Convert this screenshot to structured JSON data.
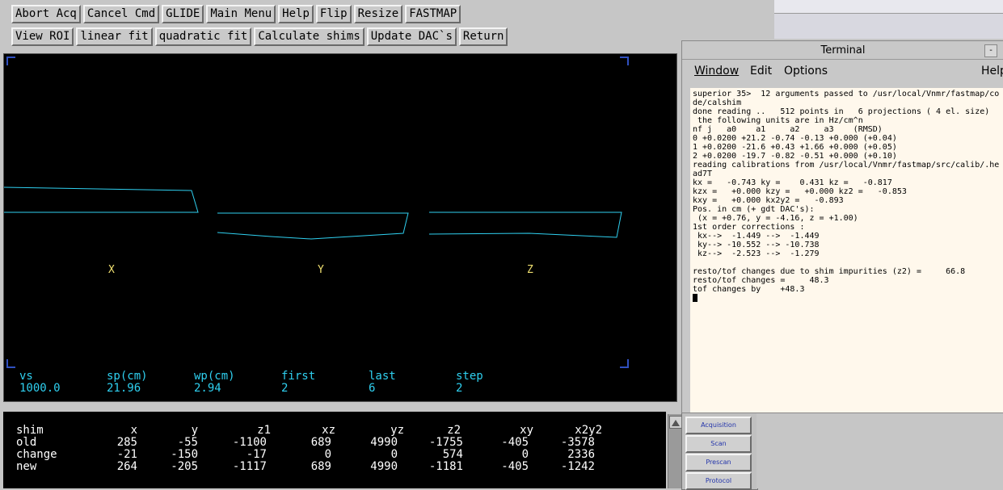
{
  "toolbar": {
    "row1": [
      "Abort Acq",
      "Cancel Cmd",
      "GLIDE",
      "Main Menu",
      "Help",
      "Flip",
      "Resize",
      "FASTMAP"
    ],
    "row2": [
      "View ROI",
      "linear fit",
      "quadratic fit",
      "Calculate shims",
      "Update DAC`s",
      "Return"
    ]
  },
  "plot": {
    "axis_labels": [
      "X",
      "Y",
      "Z"
    ],
    "params": {
      "headers": [
        "vs",
        "sp(cm)",
        "wp(cm)",
        "first",
        "last",
        "step"
      ],
      "values": [
        "1000.0",
        "21.96",
        "2.94",
        "2",
        "6",
        "2"
      ]
    }
  },
  "shims": {
    "headers": [
      "shim",
      "x",
      "y",
      "z1",
      "xz",
      "yz",
      "z2",
      "xy",
      "x2y2"
    ],
    "rows": [
      [
        "old",
        "285",
        "-55",
        "-1100",
        "689",
        "4990",
        "-1755",
        "-405",
        "-3578"
      ],
      [
        "change",
        "-21",
        "-150",
        "-17",
        "0",
        "0",
        "574",
        "0",
        "2336"
      ],
      [
        "new",
        "264",
        "-205",
        "-1117",
        "689",
        "4990",
        "-1181",
        "-405",
        "-1242"
      ]
    ]
  },
  "side_buttons": [
    "Acquisition",
    "Scan",
    "Prescan",
    "Protocol"
  ],
  "terminal": {
    "title": "Terminal",
    "menu": [
      "Window",
      "Edit",
      "Options",
      "Help"
    ],
    "lines": [
      "superior 35>  12 arguments passed to /usr/local/Vnmr/fastmap/co",
      "de/calshim",
      "done reading ..   512 points in   6 projections ( 4 el. size)",
      " the following units are in Hz/cm^n",
      "nf j   a0    a1     a2     a3    (RMSD)",
      "0 +0.0200 +21.2 -0.74 -0.13 +0.000 (+0.04)",
      "1 +0.0200 -21.6 +0.43 +1.66 +0.000 (+0.05)",
      "2 +0.0200 -19.7 -0.82 -0.51 +0.000 (+0.10)",
      "reading calibrations from /usr/local/Vnmr/fastmap/src/calib/.he",
      "ad7T",
      "kx =   -0.743 ky =    0.431 kz =   -0.817",
      "kzx =   +0.000 kzy =   +0.000 kz2 =   -0.853",
      "kxy =   +0.000 kx2y2 =   -0.893",
      "Pos. in cm (+ gdt DAC's):",
      " (x = +0.76, y = -4.16, z = +1.00)",
      "1st order corrections :",
      " kx-->  -1.449 -->  -1.449",
      " ky--> -10.552 --> -10.738",
      " kz-->  -2.523 -->  -1.279",
      "",
      "resto/tof changes due to shim impurities (z2) =     66.8",
      "resto/tof changes =     48.3",
      "tof changes by    +48.3"
    ]
  },
  "colors": {
    "canvas_bg": "#000000",
    "trace": "#2fd0f0",
    "axis_label": "#f0e070",
    "terminal_bg": "#fff8ec"
  }
}
